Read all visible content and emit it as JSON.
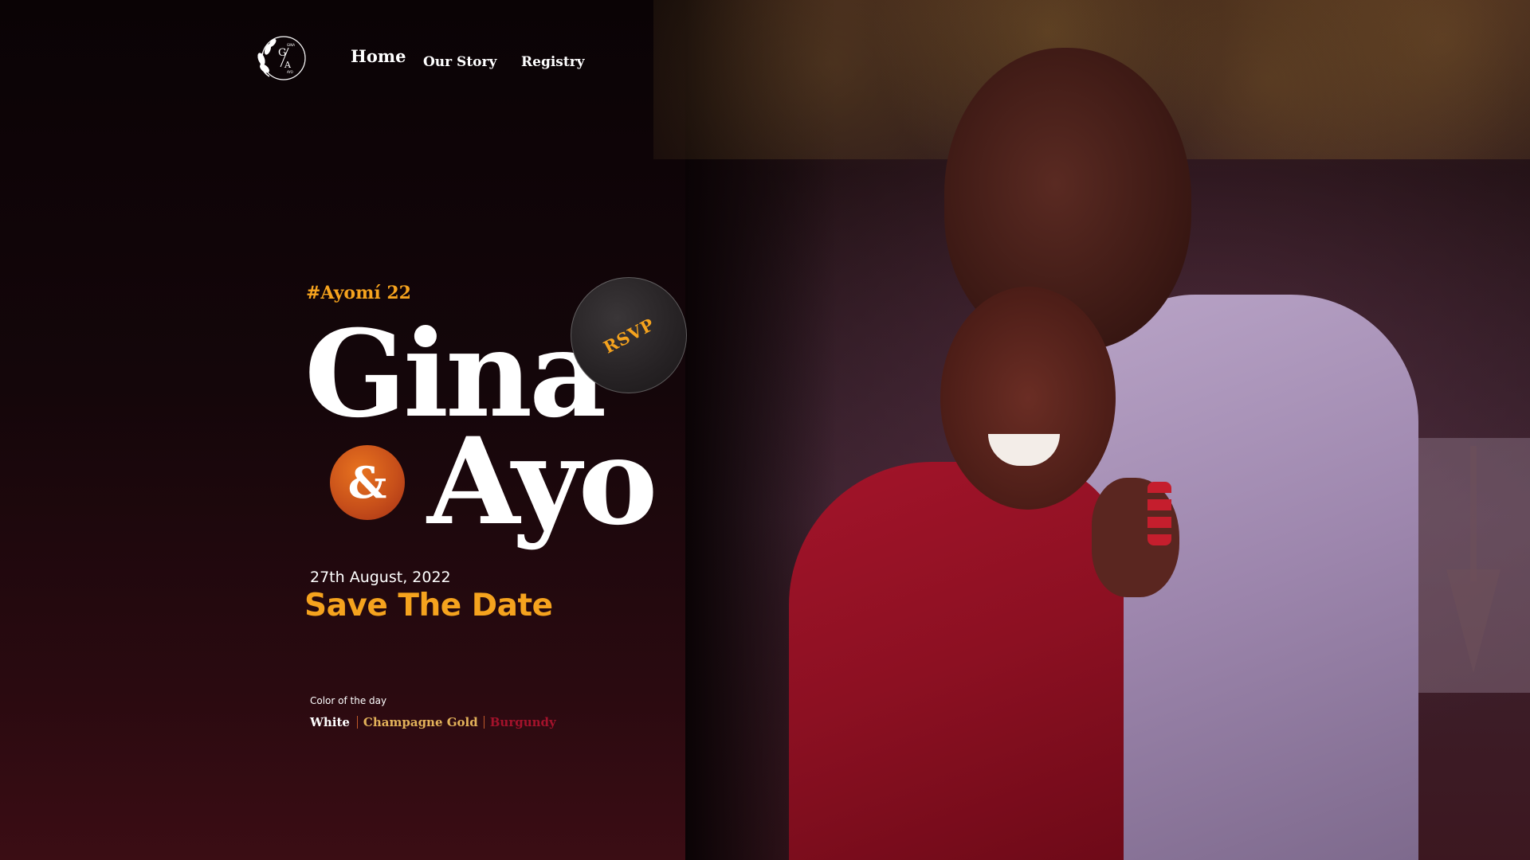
{
  "nav": {
    "home": "Home",
    "our_story": "Our Story",
    "registry": "Registry"
  },
  "logo": {
    "initial_top": "G",
    "initial_bottom": "A",
    "small_top": "GINA",
    "small_bottom": "AYO"
  },
  "hero": {
    "hashtag": "#Ayomí 22",
    "name_one": "Gina",
    "ampersand": "&",
    "name_two": "Ayo",
    "rsvp": "RSVP",
    "date": "27th August, 2022",
    "headline": "Save The Date"
  },
  "colors_of_day": {
    "label": "Color of the day",
    "items": [
      "White",
      "Champagne Gold",
      "Burgundy"
    ],
    "accent_gold": "#f5a31e",
    "accent_burgundy": "#a3122b",
    "accent_champagne": "#e3b25a"
  }
}
